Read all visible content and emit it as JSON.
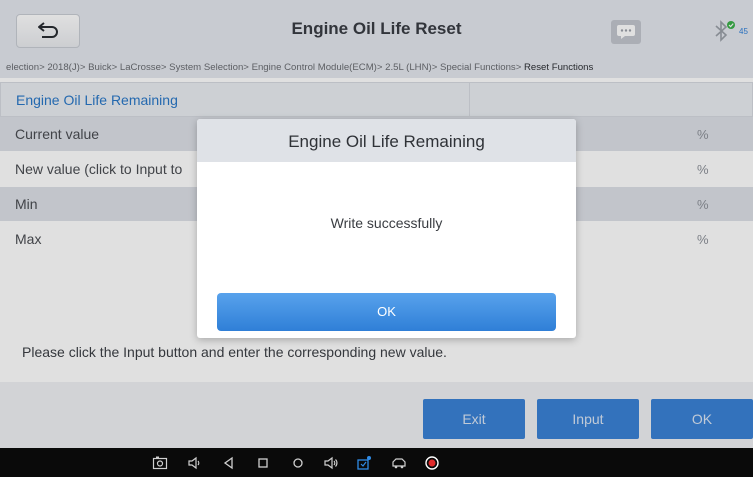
{
  "header": {
    "title": "Engine Oil Life Reset",
    "bluetooth_label": "45"
  },
  "breadcrumb": {
    "path": "election> 2018(J)> Buick> LaCrosse> System Selection> Engine Control Module(ECM)> 2.5L (LHN)> Special Functions>",
    "current": "Reset Functions"
  },
  "table": {
    "header": "Engine Oil Life Remaining",
    "rows": [
      {
        "label": "Current value",
        "unit": "%"
      },
      {
        "label": "New value (click to Input to",
        "unit": "%"
      },
      {
        "label": "Min",
        "unit": "%"
      },
      {
        "label": "Max",
        "unit": "%"
      }
    ]
  },
  "hint": "Please click the Input button and enter the corresponding new value.",
  "actions": {
    "exit_label": "Exit",
    "input_label": "Input",
    "ok_label": "OK"
  },
  "dialog": {
    "title": "Engine Oil Life Remaining",
    "message": "Write successfully",
    "ok_label": "OK"
  },
  "colors": {
    "accent": "#3b82d6",
    "header_bg": "#e4e7ee",
    "row_shade": "#dde1e8"
  },
  "system_bar_icons": [
    "screenshot-icon",
    "volume-down-icon",
    "back-nav-icon",
    "home-nav-icon",
    "circle-nav-icon",
    "volume-up-icon",
    "vci-icon",
    "car-icon",
    "record-icon"
  ]
}
